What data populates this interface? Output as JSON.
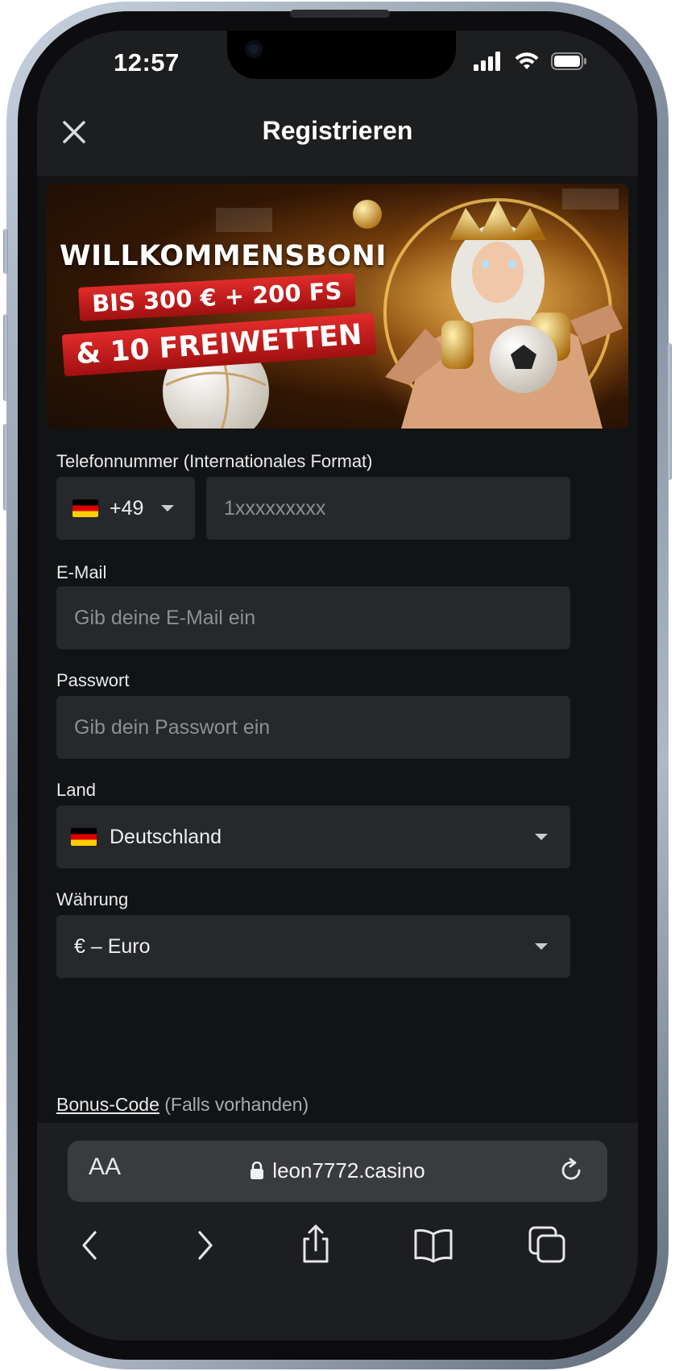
{
  "status_bar": {
    "time": "12:57"
  },
  "header": {
    "title": "Registrieren"
  },
  "banner": {
    "title": "WILLKOMMENSBONI",
    "line1": "BIS 300 € + 200 FS",
    "line2": "& 10 FREIWETTEN"
  },
  "form": {
    "phone_label": "Telefonnummer (Internationales Format)",
    "phone_code": "+49",
    "phone_placeholder": "1xxxxxxxxx",
    "email_label": "E-Mail",
    "email_placeholder": "Gib deine E-Mail ein",
    "password_label": "Passwort",
    "password_placeholder": "Gib dein Passwort ein",
    "country_label": "Land",
    "country_value": "Deutschland",
    "currency_label": "Währung",
    "currency_value": "€ – Euro",
    "bonus_link": "Bonus-Code",
    "bonus_hint": "(Falls vorhanden)"
  },
  "browser": {
    "text_size_label": "AA",
    "url": "leon7772.casino"
  },
  "icons": [
    "close-icon",
    "chevron-down-icon",
    "lock-icon",
    "reload-icon",
    "back-icon",
    "forward-icon",
    "share-icon",
    "bookmarks-icon",
    "tabs-icon",
    "signal-icon",
    "wifi-icon",
    "battery-icon"
  ],
  "colors": {
    "background": "#121314",
    "header": "#1d1e20",
    "field": "#26282b",
    "accent_red": "#e22b2b"
  }
}
